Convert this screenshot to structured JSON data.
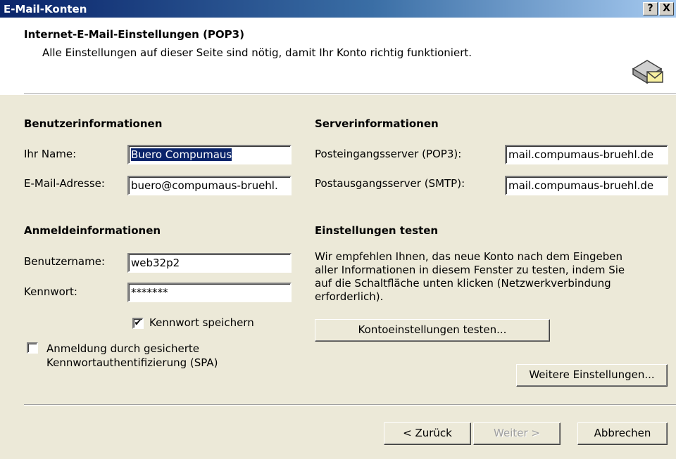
{
  "window": {
    "title": "E-Mail-Konten",
    "help_label": "?",
    "close_label": "X"
  },
  "header": {
    "title": "Internet-E-Mail-Einstellungen (POP3)",
    "subtitle": "Alle Einstellungen auf dieser Seite sind nötig, damit Ihr Konto richtig funktioniert.",
    "icon": "mail-server-icon"
  },
  "user_info": {
    "heading": "Benutzerinformationen",
    "name_label": "Ihr Name:",
    "name_value": "Buero Compumaus",
    "email_label": "E-Mail-Adresse:",
    "email_value": "buero@compumaus-bruehl."
  },
  "server_info": {
    "heading": "Serverinformationen",
    "incoming_label": "Posteingangsserver (POP3):",
    "incoming_value": "mail.compumaus-bruehl.de",
    "outgoing_label": "Postausgangsserver (SMTP):",
    "outgoing_value": "mail.compumaus-bruehl.de"
  },
  "login_info": {
    "heading": "Anmeldeinformationen",
    "username_label": "Benutzername:",
    "username_value": "web32p2",
    "password_label": "Kennwort:",
    "password_value": "*******",
    "save_password_label": "Kennwort speichern",
    "save_password_checked": true,
    "spa_label_line1": "Anmeldung durch gesicherte",
    "spa_label_line2": "Kennwortauthentifizierung (SPA)",
    "spa_checked": false
  },
  "test_settings": {
    "heading": "Einstellungen testen",
    "text_line1": "Wir empfehlen Ihnen, das neue Konto nach dem Eingeben",
    "text_line2": "aller Informationen in diesem Fenster zu testen, indem Sie",
    "text_line3": "auf die Schaltfläche unten klicken (Netzwerkverbindung",
    "text_line4": "erforderlich).",
    "test_button": "Kontoeinstellungen testen...",
    "more_button": "Weitere Einstellungen..."
  },
  "footer": {
    "back_button": "< Zurück",
    "next_button": "Weiter >",
    "cancel_button": "Abbrechen"
  }
}
